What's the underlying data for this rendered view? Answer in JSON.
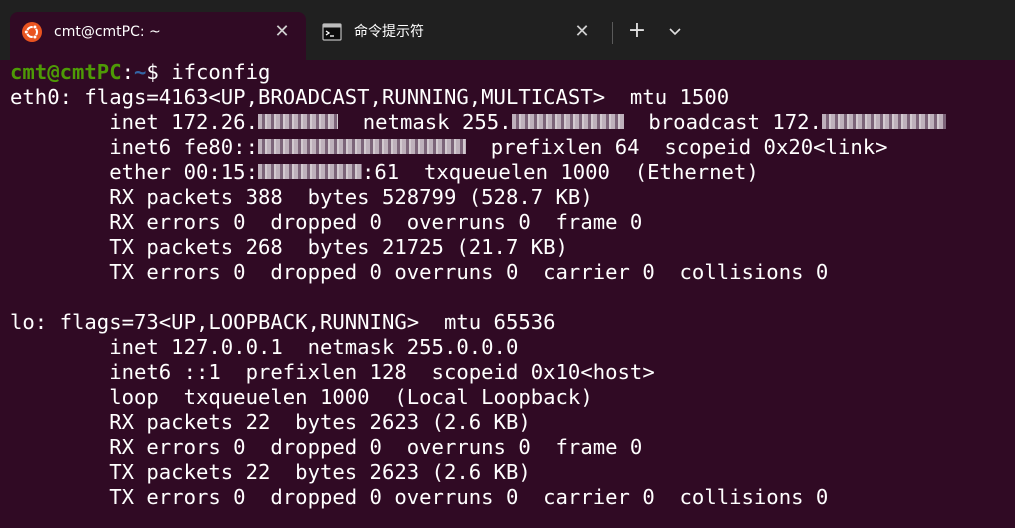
{
  "tabs": [
    {
      "label": "cmt@cmtPC: ~",
      "icon": "ubuntu-icon",
      "active": true
    },
    {
      "label": "命令提示符",
      "icon": "cmd-icon",
      "active": false
    }
  ],
  "titlebar": {
    "new_tab": "+",
    "close_glyph": "✕"
  },
  "prompt": {
    "user_host": "cmt@cmtPC",
    "colon": ":",
    "path": "~",
    "dollar": "$ ",
    "command": "ifconfig"
  },
  "output": {
    "eth0": {
      "header": "eth0: flags=4163<UP,BROADCAST,RUNNING,MULTICAST>  mtu 1500",
      "inet_pre": "        inet 172.26.",
      "netmask_pre": "  netmask 255.",
      "broadcast_pre": "  broadcast 172.",
      "inet6_pre": "        inet6 fe80::",
      "inet6_post": "  prefixlen 64  scopeid 0x20<link>",
      "ether_pre": "        ether 00:15:",
      "ether_post": ":61  txqueuelen 1000  (Ethernet)",
      "rx_packets": "        RX packets 388  bytes 528799 (528.7 KB)",
      "rx_errors": "        RX errors 0  dropped 0  overruns 0  frame 0",
      "tx_packets": "        TX packets 268  bytes 21725 (21.7 KB)",
      "tx_errors": "        TX errors 0  dropped 0 overruns 0  carrier 0  collisions 0"
    },
    "lo": {
      "header": "lo: flags=73<UP,LOOPBACK,RUNNING>  mtu 65536",
      "inet": "        inet 127.0.0.1  netmask 255.0.0.0",
      "inet6": "        inet6 ::1  prefixlen 128  scopeid 0x10<host>",
      "loop": "        loop  txqueuelen 1000  (Local Loopback)",
      "rx_packets": "        RX packets 22  bytes 2623 (2.6 KB)",
      "rx_errors": "        RX errors 0  dropped 0  overruns 0  frame 0",
      "tx_packets": "        TX packets 22  bytes 2623 (2.6 KB)",
      "tx_errors": "        TX errors 0  dropped 0 overruns 0  carrier 0  collisions 0"
    }
  },
  "colors": {
    "background": "#300a24",
    "titlebar": "#202020",
    "prompt_user": "#4e9a06",
    "prompt_path": "#3465a4",
    "ubuntu_orange": "#e95420"
  }
}
